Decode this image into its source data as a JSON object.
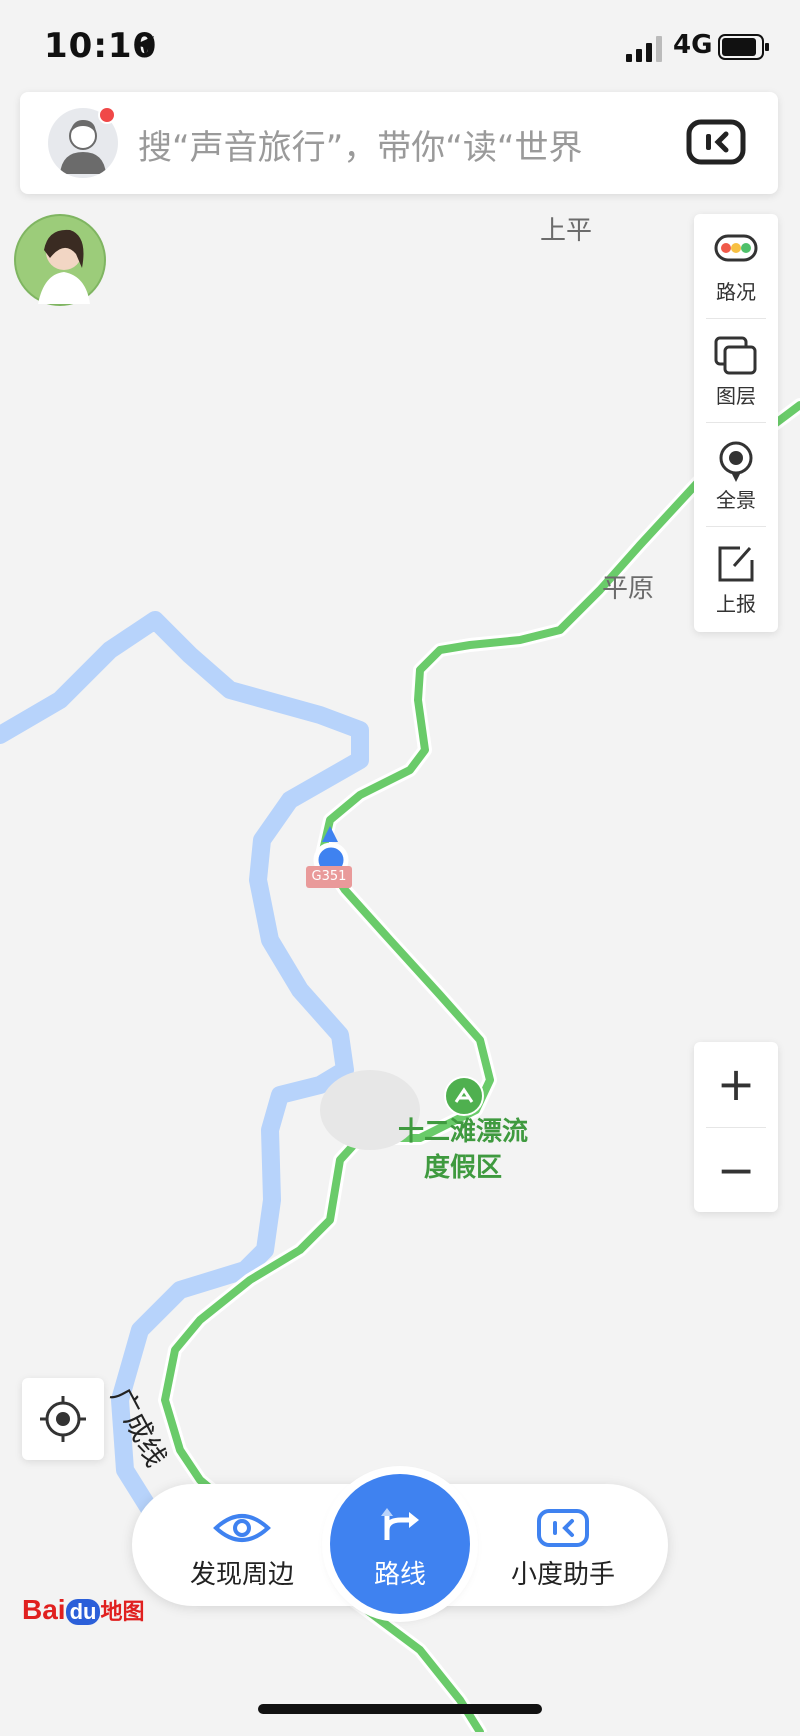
{
  "status_bar": {
    "time": "10:10",
    "network": "4G"
  },
  "search": {
    "placeholder": "搜“声音旅行”，带你“读“世界"
  },
  "map": {
    "places": {
      "shangping": "上平",
      "pingyuan": "平原"
    },
    "road_name": "广成线",
    "road_shield": "G351",
    "poi": {
      "name_line1": "十二滩漂流",
      "name_line2": "度假区"
    },
    "colors": {
      "river": "#b7d3fb",
      "road": "#6acb6a",
      "location_dot": "#3f82f0"
    }
  },
  "toolbar": {
    "traffic": "路况",
    "layers": "图层",
    "panorama": "全景",
    "report": "上报"
  },
  "zoom": {
    "in": "+",
    "out": "−"
  },
  "bottom_bar": {
    "discover": "发现周边",
    "route": "路线",
    "assistant": "小度助手"
  },
  "logo": {
    "text1": "Bai",
    "text2": "du",
    "text3": "地图"
  },
  "icons": [
    "location-arrow-icon",
    "signal-icon",
    "battery-icon",
    "profile-avatar-icon",
    "assistant-icon",
    "traffic-icon",
    "layers-icon",
    "panorama-icon",
    "report-icon",
    "locate-icon",
    "eye-icon",
    "route-arrow-icon"
  ]
}
